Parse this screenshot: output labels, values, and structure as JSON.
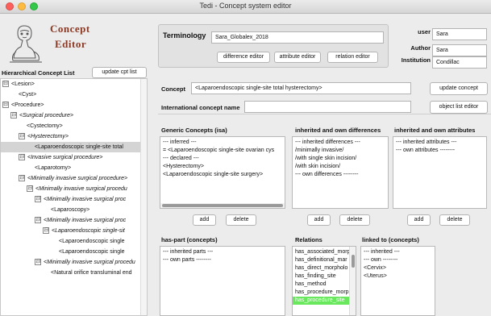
{
  "window": {
    "title": "Tedi - Concept system editor"
  },
  "logo": {
    "line1": "Concept",
    "line2": "Editor"
  },
  "hierarchy": {
    "label": "Hierarchical Concept List",
    "update_button": "update cpt list",
    "rows": [
      {
        "text": "<Lesion>",
        "expander": "⊟",
        "italic": false,
        "selected": false
      },
      {
        "text": "<Cyst>",
        "expander": "",
        "italic": false,
        "selected": false
      },
      {
        "text": "<Procedure>",
        "expander": "⊟",
        "italic": false,
        "selected": false
      },
      {
        "text": "<Surgical procedure>",
        "expander": "⊟",
        "italic": true,
        "selected": false
      },
      {
        "text": "<Cystectomy>",
        "expander": "",
        "italic": false,
        "selected": false
      },
      {
        "text": "<Hysterectomy>",
        "expander": "⊟",
        "italic": true,
        "selected": false
      },
      {
        "text": "<Laparoendoscopic single-site total",
        "expander": "",
        "italic": false,
        "selected": true
      },
      {
        "text": "<Invasive surgical procedure>",
        "expander": "⊟",
        "italic": true,
        "selected": false
      },
      {
        "text": "<Laparotomy>",
        "expander": "",
        "italic": false,
        "selected": false
      },
      {
        "text": "<Minimally invasive surgical procedure>",
        "expander": "⊟",
        "italic": true,
        "selected": false
      },
      {
        "text": "<Minimally invasive surgical procedu",
        "expander": "⊟",
        "italic": true,
        "selected": false
      },
      {
        "text": "<Minimally invasive surgical proc",
        "expander": "⊟",
        "italic": true,
        "selected": false
      },
      {
        "text": "<Laparoscopy>",
        "expander": "",
        "italic": false,
        "selected": false
      },
      {
        "text": "<Minimally invasive surgical proc",
        "expander": "⊟",
        "italic": true,
        "selected": false
      },
      {
        "text": "<Laparoendoscopic single-sit",
        "expander": "⊟",
        "italic": true,
        "selected": false
      },
      {
        "text": "<Laparoendoscopic single",
        "expander": "",
        "italic": false,
        "selected": false
      },
      {
        "text": "<Laparoendoscopic single",
        "expander": "",
        "italic": false,
        "selected": false
      },
      {
        "text": "<Minimally invasive surgical procedu",
        "expander": "⊟",
        "italic": true,
        "selected": false
      },
      {
        "text": "<Natural orifice transluminal end",
        "expander": "",
        "italic": false,
        "selected": false
      }
    ]
  },
  "terminology": {
    "label": "Terminology",
    "value": "Sara_Globalex_2018",
    "difference_button": "difference editor",
    "attribute_button": "attribute editor",
    "relation_button": "relation editor"
  },
  "user": {
    "user_label": "user",
    "user_value": "Sara",
    "author_label": "Author",
    "author_value": "Sara",
    "institution_label": "Institution",
    "institution_value": "Condillac"
  },
  "concept": {
    "label": "Concept",
    "value": "<Laparoendoscopic single-site total hysterectomy>",
    "update_button": "update concept",
    "intl_label": "International concept name",
    "intl_value": "",
    "object_list_button": "object list editor"
  },
  "generic": {
    "header": "Generic Concepts (isa)",
    "lines": [
      "--- inferred  ---",
      "= <Laparoendoscopic single-site ovarian cys",
      "--- declared ---",
      "<Hysterectomy>",
      "<Laparoendoscopic single-site surgery>"
    ],
    "add": "add",
    "delete": "delete"
  },
  "differences": {
    "header": "inherited and own differences",
    "lines": [
      "--- inherited differences ---",
      "/minimally invasive/",
      "/with single skin incision/",
      "/with skin incision/",
      "--- own differences --------"
    ],
    "add": "add",
    "delete": "delete"
  },
  "attributes": {
    "header": "inherited and own attributes",
    "lines": [
      "--- inherited attributes ---",
      "--- own attributes --------"
    ],
    "add": "add",
    "delete": "delete"
  },
  "has_part": {
    "header": "has-part (concepts)",
    "lines": [
      "--- inherited parts ---",
      "--- own parts --------"
    ]
  },
  "relations": {
    "header": "Relations",
    "lines": [
      "has_associated_morp",
      "has_definitional_mar",
      "has_direct_morpholo",
      "has_finding_site",
      "has_method",
      "has_procedure_morp",
      "has_procedure_site"
    ],
    "selected_index": 6
  },
  "linked": {
    "header": "linked to (concepts)",
    "lines": [
      "--- inherited ---",
      "--- own --------",
      "<Cervix>",
      "<Uterus>"
    ]
  },
  "colors": {
    "accent_logo": "#8a3a24",
    "selection_green": "#69e85e"
  }
}
